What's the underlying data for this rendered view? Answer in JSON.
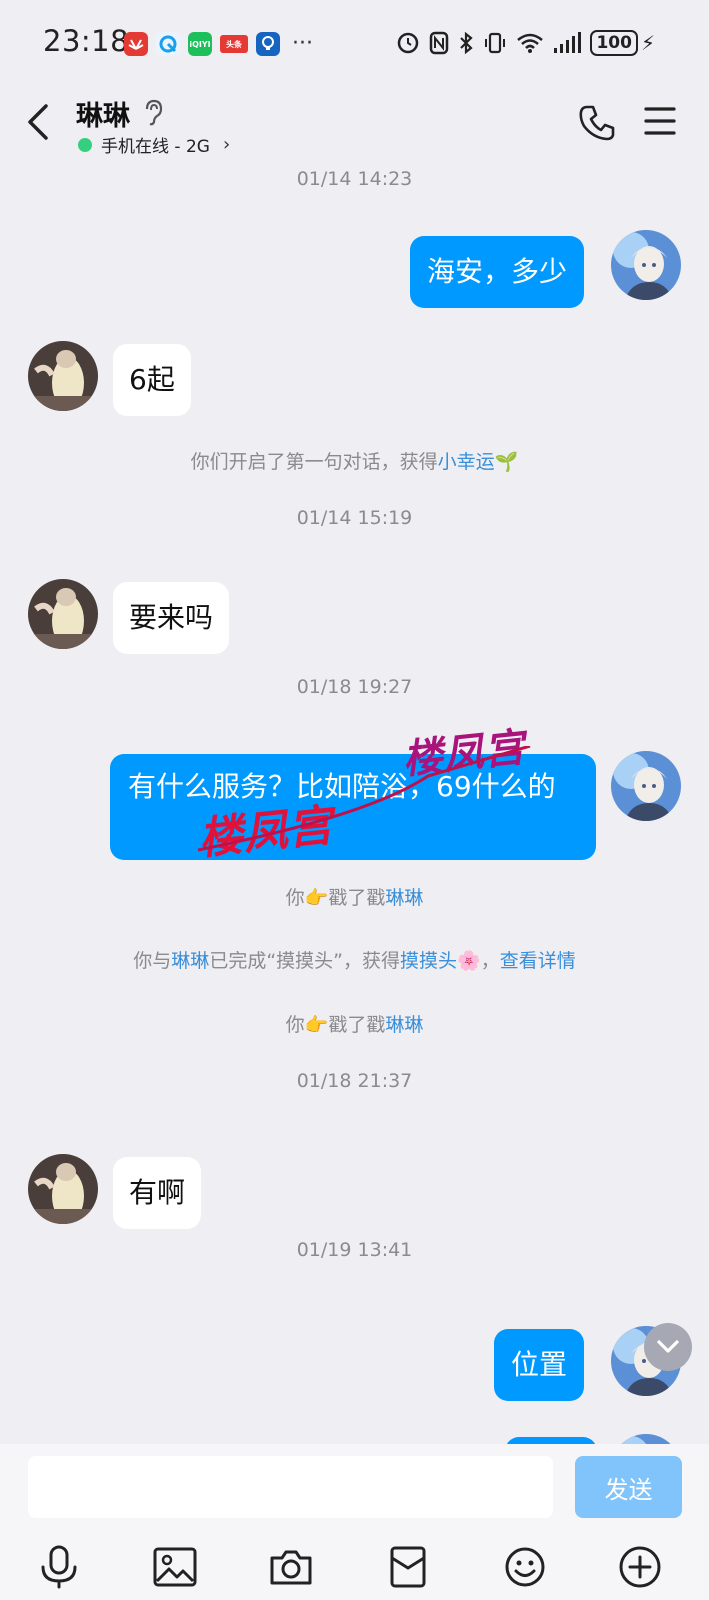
{
  "status_bar": {
    "time": "23:18",
    "app_icons": [
      {
        "name": "huawei-icon",
        "color": "#e33b34",
        "text": ""
      },
      {
        "name": "browser-icon",
        "color": "#1aa0e8",
        "text": ""
      },
      {
        "name": "iqiyi-icon",
        "color": "#1dbf5a",
        "text": "iQIYI"
      },
      {
        "name": "toutiao-icon",
        "color": "#e53935",
        "text": "头条"
      },
      {
        "name": "tips-icon",
        "color": "#1565c0",
        "text": ""
      }
    ],
    "more": "···",
    "battery": "100"
  },
  "header": {
    "title": "琳琳",
    "status": "手机在线 - 2G",
    "online_color": "#35d07f"
  },
  "messages": [
    {
      "kind": "time",
      "text": "01/14 14:23"
    },
    {
      "kind": "out",
      "text": "海安，多少"
    },
    {
      "kind": "in",
      "text": "6起"
    },
    {
      "kind": "system",
      "pre": "你们开启了第一句对话，获得",
      "link": "小幸运",
      "emoji": "🌱"
    },
    {
      "kind": "time",
      "text": "01/14 15:19"
    },
    {
      "kind": "in",
      "text": "要来吗"
    },
    {
      "kind": "time",
      "text": "01/18 19:27"
    },
    {
      "kind": "out",
      "text": "  有什么服务？比如陪浴，69什么的"
    },
    {
      "kind": "system",
      "pre": "你",
      "emoji": "👉",
      "mid": "戳了戳",
      "link": "琳琳"
    },
    {
      "kind": "system",
      "pre": "你与",
      "link": "琳琳",
      "mid": "已完成“摸摸头”，获得",
      "link2": "摸摸头",
      "emoji": "🌸",
      "sep": "，",
      "link3": "查看详情"
    },
    {
      "kind": "system",
      "pre": "你",
      "emoji": "👉",
      "mid": "戳了戳",
      "link": "琳琳"
    },
    {
      "kind": "time",
      "text": "01/18 21:37"
    },
    {
      "kind": "in",
      "text": "有啊"
    },
    {
      "kind": "time",
      "text": "01/19 13:41"
    },
    {
      "kind": "out",
      "text": "位置"
    }
  ],
  "watermark": {
    "text": "楼凤宫"
  },
  "input": {
    "value": "",
    "placeholder": ""
  },
  "send_label": "发送",
  "colors": {
    "bubble_out": "#0099ff",
    "bubble_in": "#ffffff",
    "background": "#eeeef3",
    "link": "#3a8fd8",
    "send_disabled": "#81c4fb"
  }
}
